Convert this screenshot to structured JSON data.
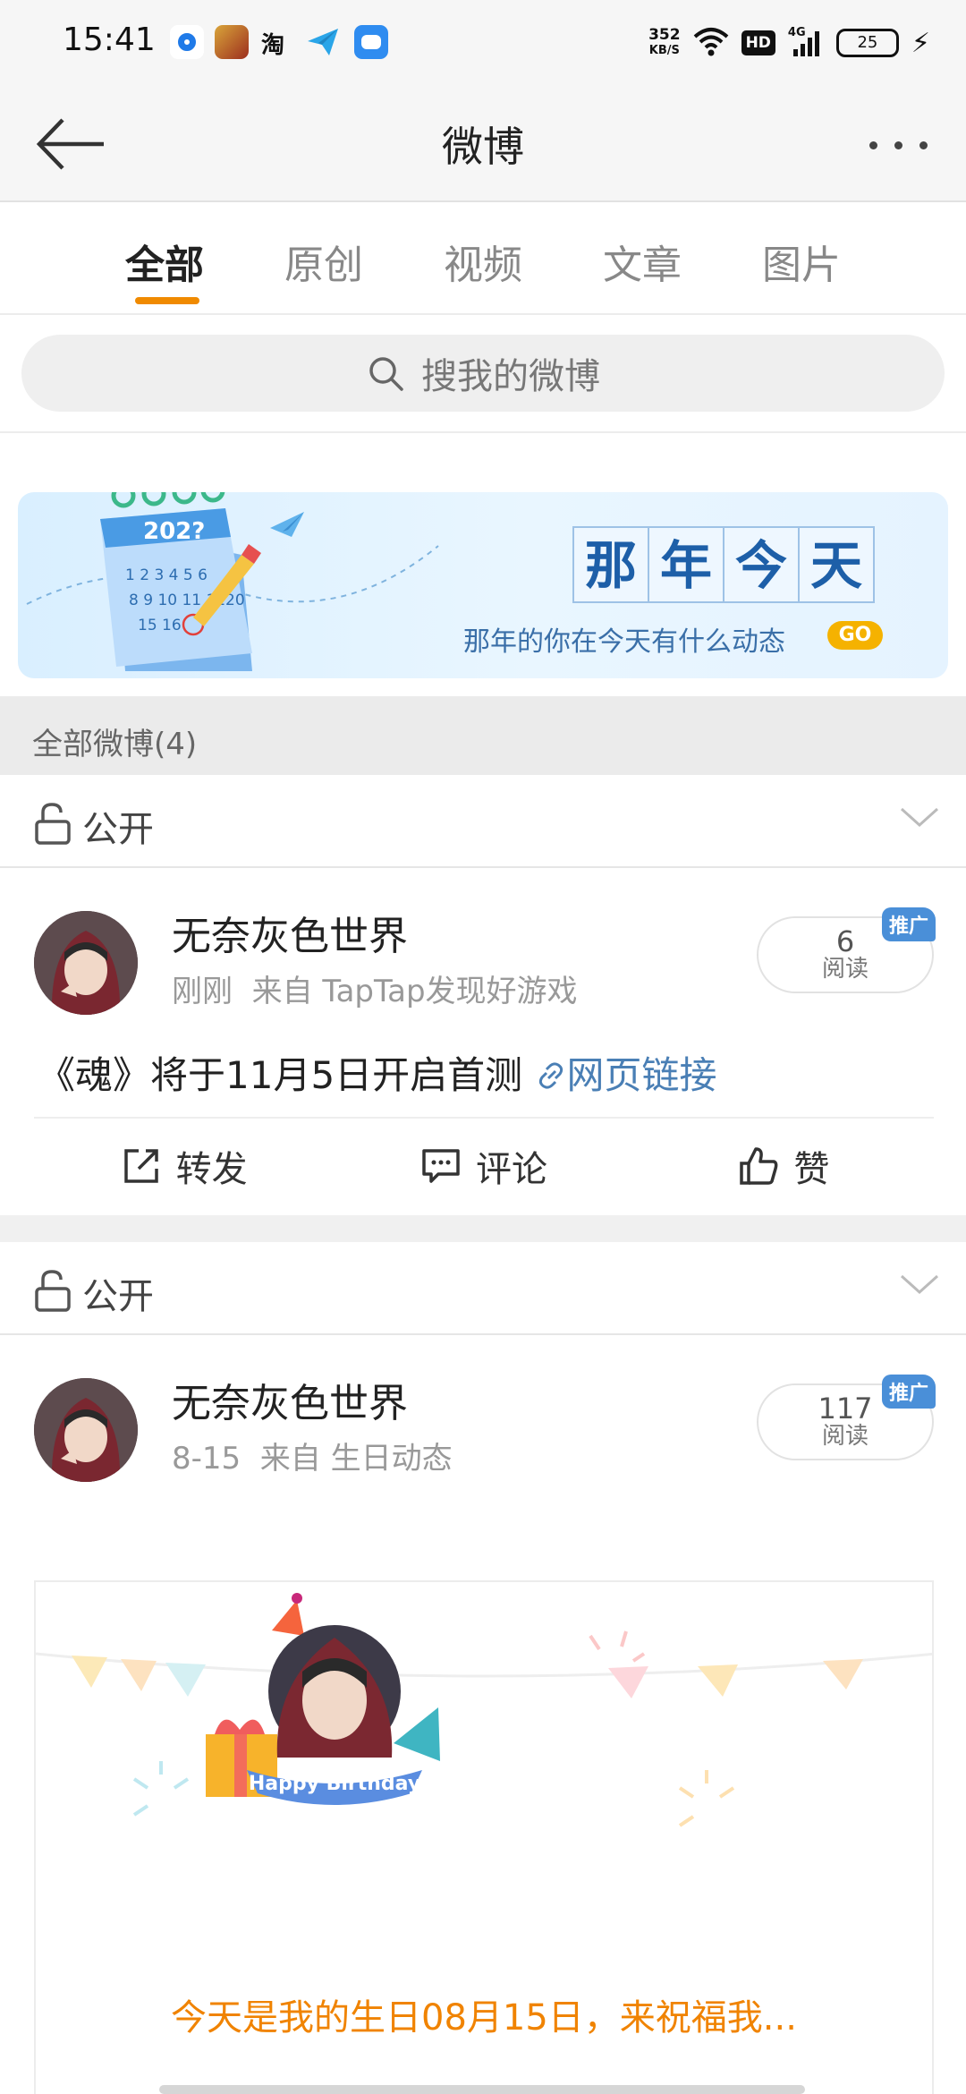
{
  "status_bar": {
    "time": "15:41",
    "taobao_glyph": "淘",
    "net_speed_value": "352",
    "net_speed_unit": "KB/S",
    "hd_label": "HD",
    "network_label": "4G",
    "battery": "25",
    "icons": [
      "blue-dot-app-icon",
      "game-app-icon",
      "taobao-icon",
      "paper-plane-app-icon",
      "chat-app-icon",
      "wifi-icon",
      "hd-icon",
      "signal-icon",
      "battery-icon",
      "charging-icon"
    ]
  },
  "header": {
    "title": "微博"
  },
  "tabs": [
    {
      "label": "全部",
      "active": true
    },
    {
      "label": "原创",
      "active": false
    },
    {
      "label": "视频",
      "active": false
    },
    {
      "label": "文章",
      "active": false
    },
    {
      "label": "图片",
      "active": false
    }
  ],
  "search": {
    "placeholder": "搜我的微博"
  },
  "banner": {
    "calendar_year": "202?",
    "title_chars": [
      "那",
      "年",
      "今",
      "天"
    ],
    "subtitle": "那年的你在今天有什么动态",
    "go_label": "GO"
  },
  "section": {
    "title": "全部微博(4)"
  },
  "posts": [
    {
      "visibility": "公开",
      "username": "无奈灰色世界",
      "time": "刚刚",
      "source": "来自 TapTap发现好游戏",
      "read_count": "6",
      "read_label": "阅读",
      "promo_badge": "推广",
      "text": "《魂》将于11月5日开启首测",
      "link_text": "网页链接",
      "actions": {
        "repost": "转发",
        "comment": "评论",
        "like": "赞"
      }
    },
    {
      "visibility": "公开",
      "username": "无奈灰色世界",
      "time": "8-15",
      "source": "来自 生日动态",
      "read_count": "117",
      "read_label": "阅读",
      "promo_badge": "推广",
      "card_ribbon": "Happy Birthday",
      "card_text": "今天是我的生日08月15日，来祝福我..."
    }
  ],
  "colors": {
    "accent": "#f08a00",
    "link": "#4a7fb5",
    "badge": "#4a8fd8",
    "banner_text": "#1d5fa8"
  }
}
